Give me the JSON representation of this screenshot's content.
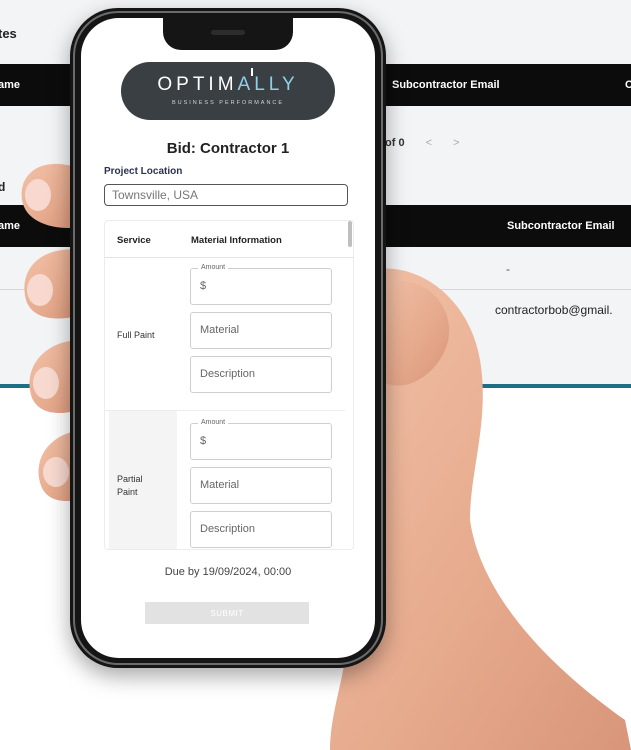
{
  "background": {
    "section_title": "tes",
    "table1": {
      "col_name": "ame",
      "col_email": "Subcontractor Email",
      "col_extra": "C"
    },
    "pager": {
      "text": "of 0",
      "prev": "<",
      "next": ">"
    },
    "section2_label": "d",
    "table2": {
      "col_name": "ame",
      "col_email": "Subcontractor Email"
    },
    "row1_email": "-",
    "row2_email": "contractorbob@gmail.",
    "accent": "#1e6f86"
  },
  "app": {
    "logo": {
      "brand_main": "OPTIM",
      "brand_accent": "ALLY",
      "tagline": "BUSINESS PERFORMANCE"
    },
    "title": "Bid: Contractor 1",
    "project_location": {
      "label": "Project Location",
      "value": "Townsville, USA"
    },
    "table": {
      "headers": {
        "service": "Service",
        "material": "Material Information"
      },
      "rows": [
        {
          "service": "Full Paint",
          "amount_label": "Amount",
          "amount": "$",
          "material": "Material",
          "description": "Description"
        },
        {
          "service": "Partial Paint",
          "amount_label": "Amount",
          "amount": "$",
          "material": "Material",
          "description": "Description"
        }
      ]
    },
    "due": "Due by 19/09/2024, 00:00",
    "submit": "SUBMIT"
  }
}
